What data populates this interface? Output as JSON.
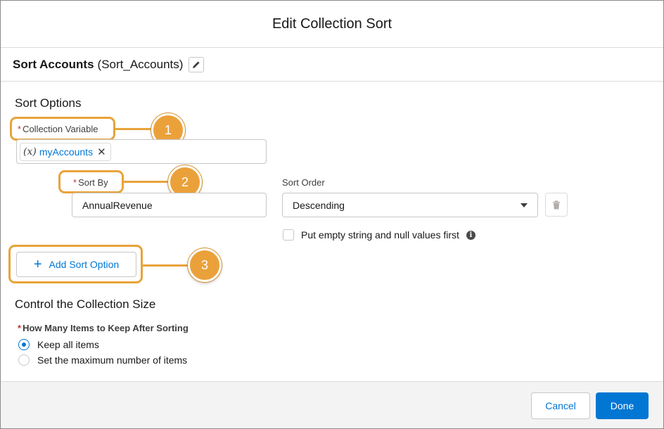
{
  "modal": {
    "title": "Edit Collection Sort"
  },
  "element": {
    "label": "Sort Accounts",
    "api_name": "(Sort_Accounts)"
  },
  "sort_options": {
    "heading": "Sort Options",
    "collection_variable": {
      "label": "Collection Variable",
      "required_mark": "*",
      "value": "myAccounts",
      "icon_text": "(x)"
    },
    "sort_by": {
      "label": "Sort By",
      "required_mark": "*",
      "value": "AnnualRevenue"
    },
    "sort_order": {
      "label": "Sort Order",
      "value": "Descending"
    },
    "nulls_first": {
      "label": "Put empty string and null values first",
      "checked": false,
      "info_glyph": "i"
    },
    "add_button": {
      "label": "Add Sort Option",
      "glyph": "+"
    }
  },
  "collection_size": {
    "heading": "Control the Collection Size",
    "question": {
      "label": "How Many Items to Keep After Sorting",
      "required_mark": "*"
    },
    "options": [
      {
        "label": "Keep all items",
        "checked": true
      },
      {
        "label": "Set the maximum number of items",
        "checked": false
      }
    ]
  },
  "callouts": [
    "1",
    "2",
    "3"
  ],
  "footer": {
    "cancel_label": "Cancel",
    "done_label": "Done"
  },
  "colors": {
    "accent": "#0176d3",
    "callout": "#eba13a",
    "required": "#c23934"
  }
}
